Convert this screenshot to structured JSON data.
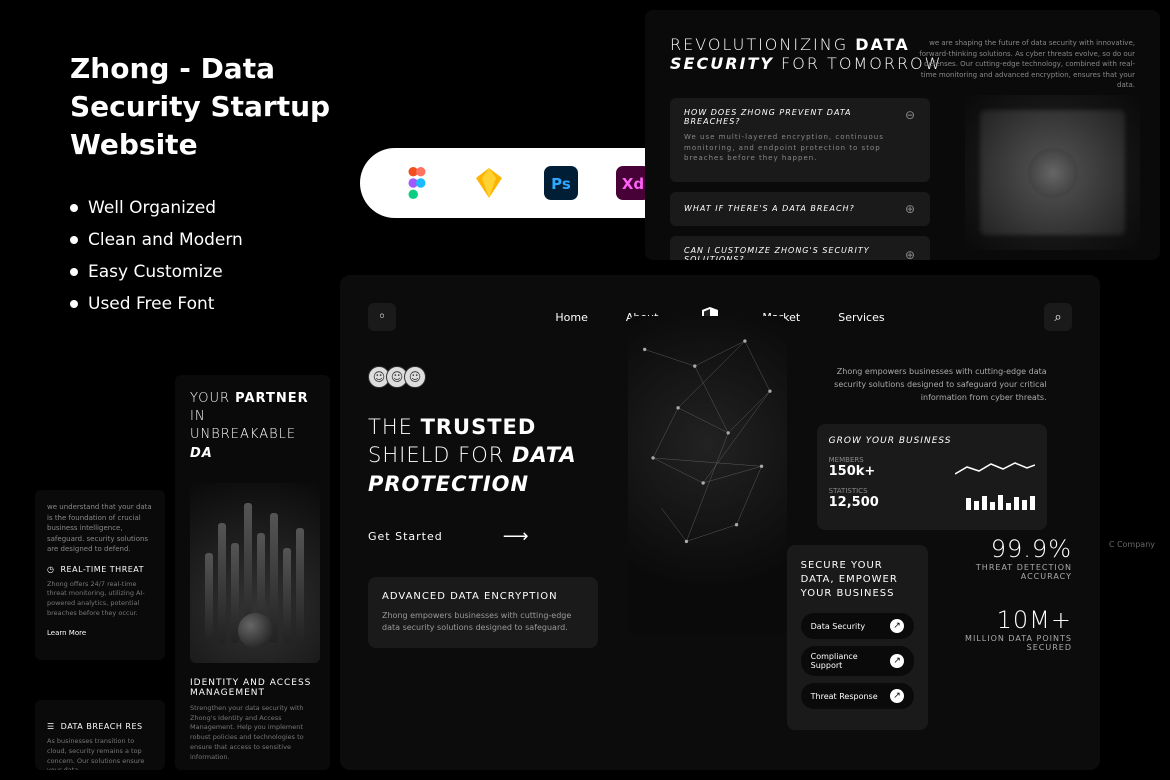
{
  "info": {
    "title": "Zhong - Data Security Startup Website",
    "features": [
      "Well Organized",
      "Clean and Modern",
      "Easy Customize",
      "Used Free Font"
    ]
  },
  "tools": [
    "Figma",
    "Sketch",
    "Photoshop",
    "Adobe XD"
  ],
  "top_preview": {
    "title_parts": [
      "REVOLUTIONIZING ",
      "DATA",
      "SECURITY",
      " FOR TOMORROW"
    ],
    "subtitle": "we are shaping the future of data security with innovative, forward-thinking solutions. As cyber threats evolve, so do our defenses. Our cutting-edge technology, combined with real-time monitoring and advanced encryption, ensures that your data.",
    "faqs": [
      {
        "q": "HOW DOES ZHONG PREVENT DATA BREACHES?",
        "a": "We use multi-layered encryption, continuous monitoring, and endpoint protection to stop breaches before they happen.",
        "open": true
      },
      {
        "q": "WHAT IF THERE'S A DATA BREACH?",
        "open": false
      },
      {
        "q": "CAN I CUSTOMIZE ZHONG'S SECURITY SOLUTIONS?",
        "open": false
      }
    ]
  },
  "main": {
    "nav": [
      "Home",
      "About",
      "Market",
      "Services"
    ],
    "hero_parts": [
      "THE ",
      "TRUSTED",
      " SHIELD FOR ",
      "DATA PROTECTION"
    ],
    "cta": "Get Started",
    "enc": {
      "title": "ADVANCED DATA ENCRYPTION",
      "body": "Zhong empowers businesses with cutting-edge data security solutions designed to safeguard."
    },
    "right_intro": "Zhong empowers businesses with cutting-edge data security solutions designed to safeguard your critical information from cyber threats.",
    "grow": {
      "title": "GROW YOUR BUSINESS",
      "members_label": "MEMBERS",
      "members": "150k+",
      "stats_label": "STATISTICS",
      "stats": "12,500"
    },
    "secure": {
      "title": "SECURE YOUR DATA, EMPOWER YOUR BUSINESS",
      "pills": [
        "Data Security",
        "Compliance Support",
        "Threat Response"
      ]
    },
    "stats": [
      {
        "value": "99.9%",
        "label": "THREAT DETECTION ACCURACY"
      },
      {
        "value": "10M+",
        "label": "MILLION DATA POINTS SECURED"
      }
    ]
  },
  "left_previews": {
    "intro": "we understand that your data is the foundation of crucial business intelligence, safeguard. security solutions are designed to defend.",
    "realtime": {
      "title": "REAL-TIME THREAT",
      "body": "Zhong offers 24/7 real-time threat monitoring, utilizing AI-powered analytics, potential breaches before they occur."
    },
    "learn": "Learn More",
    "breach": {
      "title": "DATA BREACH RES",
      "body": "As businesses transition to cloud, security remains a top concern. Our solutions ensure your data."
    },
    "partner_parts": [
      "YOUR ",
      "PARTNER",
      " IN UNBREAKABLE ",
      "DA"
    ],
    "iam": {
      "title": "IDENTITY AND ACCESS MANAGEMENT",
      "body": "Strengthen your data security with Zhong's Identity and Access Management. Help you implement robust policies and technologies to ensure that access to sensitive information."
    }
  },
  "company": "C Company",
  "chart_data": {
    "type": "bar",
    "title": "GROW YOUR BUSINESS",
    "categories": [
      "",
      "",
      "",
      "",
      "",
      "",
      "",
      "",
      ""
    ],
    "values": [
      12,
      9,
      14,
      8,
      15,
      7,
      13,
      10,
      14
    ],
    "ylim": [
      0,
      20
    ]
  }
}
